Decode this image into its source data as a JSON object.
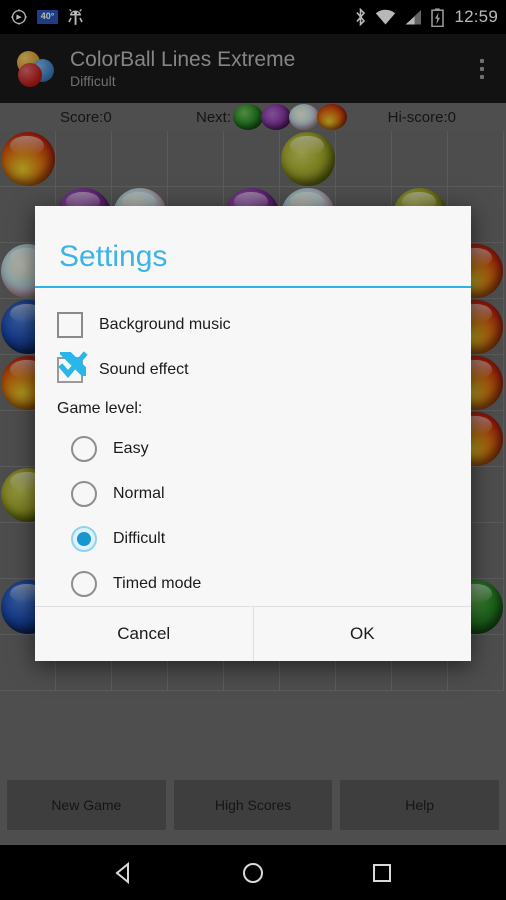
{
  "status_bar": {
    "temperature": "40°",
    "clock": "12:59",
    "left_icons": [
      "compass-icon",
      "temperature-badge",
      "android-bug-icon"
    ],
    "right_icons": [
      "bluetooth-icon",
      "wifi-icon",
      "cellular-signal-icon",
      "battery-charging-icon"
    ]
  },
  "action_bar": {
    "title": "ColorBall Lines Extreme",
    "subtitle": "Difficult",
    "overflow_label": "overflow-menu"
  },
  "game": {
    "score_label": "Score:0",
    "next_label": "Next:",
    "hiscore_label": "Hi-score:0",
    "next_balls": [
      "green",
      "purple",
      "pearl",
      "red"
    ],
    "buttons": [
      {
        "label": "New Game",
        "name": "new-game-button"
      },
      {
        "label": "High Scores",
        "name": "high-scores-button"
      },
      {
        "label": "Help",
        "name": "help-button"
      }
    ],
    "board": {
      "cols": 9,
      "rows": 10,
      "cell_size": 56,
      "balls": [
        {
          "r": 0,
          "c": 0,
          "color": "red"
        },
        {
          "r": 0,
          "c": 5,
          "color": "olive"
        },
        {
          "r": 1,
          "c": 1,
          "color": "purple"
        },
        {
          "r": 1,
          "c": 2,
          "color": "pearl"
        },
        {
          "r": 1,
          "c": 4,
          "color": "purple"
        },
        {
          "r": 1,
          "c": 5,
          "color": "pearl"
        },
        {
          "r": 1,
          "c": 7,
          "color": "olive"
        },
        {
          "r": 2,
          "c": 0,
          "color": "pearl"
        },
        {
          "r": 2,
          "c": 8,
          "color": "red"
        },
        {
          "r": 3,
          "c": 0,
          "color": "blue"
        },
        {
          "r": 3,
          "c": 8,
          "color": "red"
        },
        {
          "r": 4,
          "c": 0,
          "color": "red"
        },
        {
          "r": 4,
          "c": 8,
          "color": "red"
        },
        {
          "r": 5,
          "c": 8,
          "color": "red"
        },
        {
          "r": 6,
          "c": 0,
          "color": "olive"
        },
        {
          "r": 8,
          "c": 0,
          "color": "blue"
        },
        {
          "r": 8,
          "c": 8,
          "color": "green"
        }
      ]
    }
  },
  "dialog": {
    "title": "Settings",
    "accent_color": "#2bb3e8",
    "checkboxes": [
      {
        "label": "Background music",
        "checked": false,
        "name": "background-music-checkbox"
      },
      {
        "label": "Sound effect",
        "checked": true,
        "name": "sound-effect-checkbox"
      }
    ],
    "group_label": "Game level:",
    "radios": [
      {
        "label": "Easy",
        "selected": false,
        "name": "level-easy-radio"
      },
      {
        "label": "Normal",
        "selected": false,
        "name": "level-normal-radio"
      },
      {
        "label": "Difficult",
        "selected": true,
        "name": "level-difficult-radio"
      },
      {
        "label": "Timed mode",
        "selected": false,
        "name": "level-timed-mode-radio"
      }
    ],
    "cancel_label": "Cancel",
    "ok_label": "OK"
  },
  "nav_bar": {
    "back": "back-icon",
    "home": "home-icon",
    "recents": "recents-icon"
  }
}
